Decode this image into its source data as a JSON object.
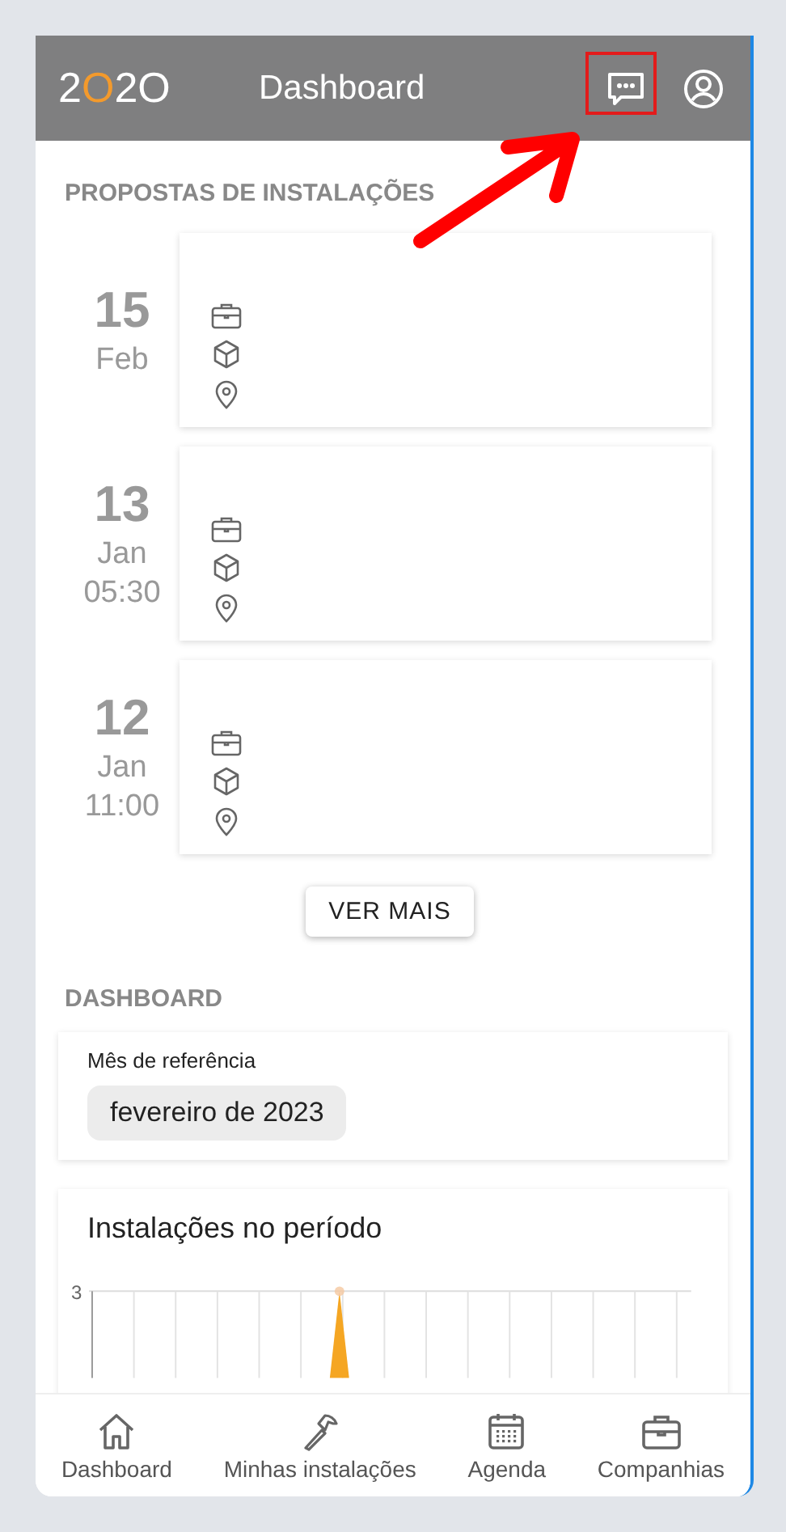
{
  "header": {
    "logo": {
      "digits": [
        "2",
        "O",
        "2",
        "O"
      ]
    },
    "title": "Dashboard"
  },
  "proposals": {
    "heading": "PROPOSTAS DE INSTALAÇÕES",
    "items": [
      {
        "day": "15",
        "month": "Feb"
      },
      {
        "day": "13",
        "month": "Jan",
        "time": "05:30"
      },
      {
        "day": "12",
        "month": "Jan",
        "time": "11:00"
      }
    ],
    "more_button": "VER MAIS"
  },
  "dashboard": {
    "heading": "DASHBOARD",
    "month_label": "Mês de referência",
    "month_value": "fevereiro de 2023",
    "chart": {
      "title": "Instalações no período",
      "y_tick": "3"
    }
  },
  "bottom_nav": [
    {
      "label": "Dashboard",
      "kind": "home"
    },
    {
      "label": "Minhas instalações",
      "kind": "tools"
    },
    {
      "label": "Agenda",
      "kind": "calendar"
    },
    {
      "label": "Companhias",
      "kind": "companies"
    }
  ]
}
